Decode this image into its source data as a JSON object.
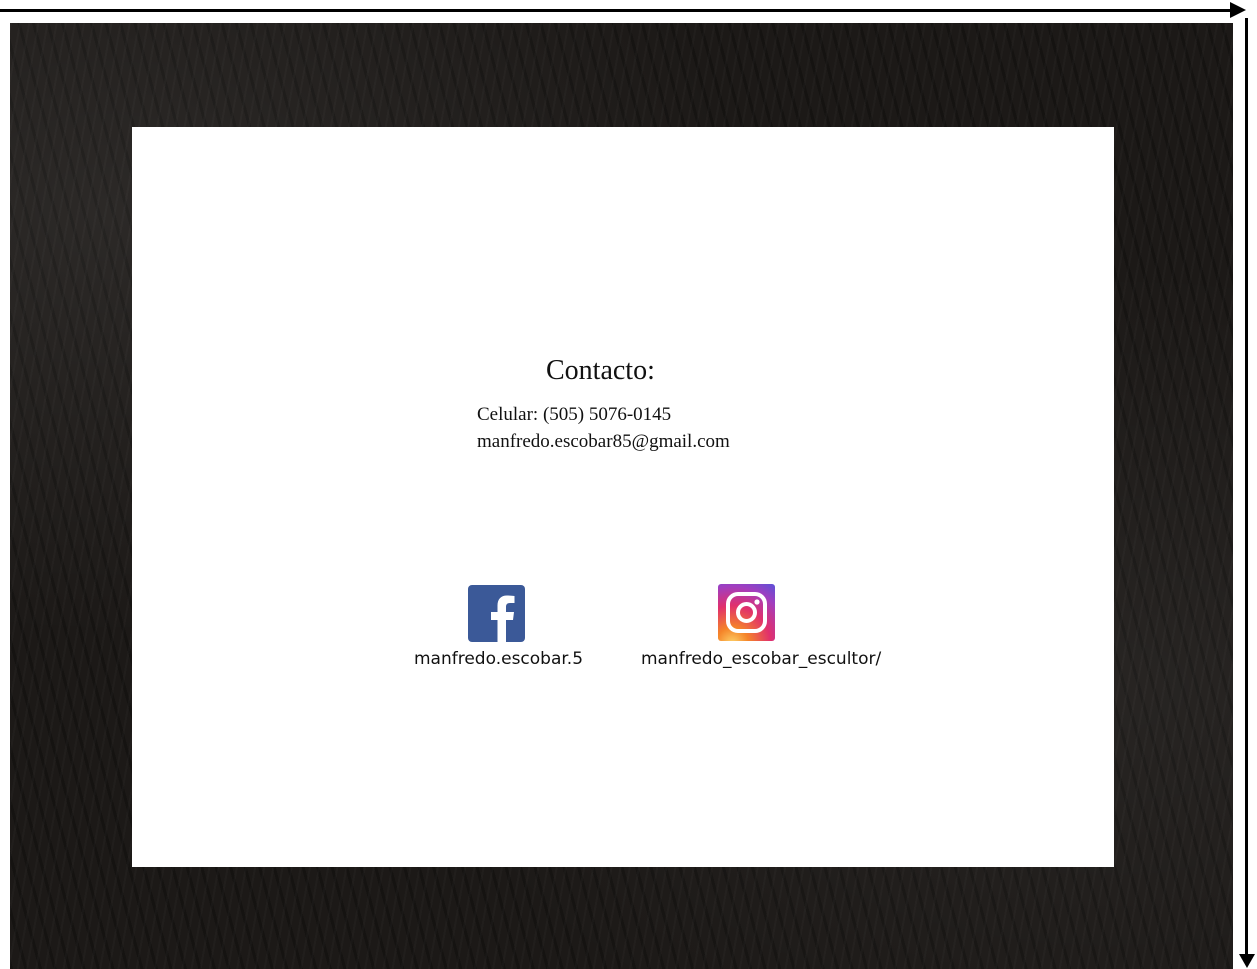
{
  "contact": {
    "title": "Contacto:",
    "phone": "Celular: (505) 5076-0145",
    "email": "manfredo.escobar85@gmail.com"
  },
  "social": {
    "facebook": {
      "icon": "facebook-icon",
      "handle": "manfredo.escobar.5",
      "color": "#3b5998"
    },
    "instagram": {
      "icon": "instagram-icon",
      "handle": "manfredo_escobar_escultor/"
    }
  },
  "colors": {
    "frame": "#1c1917",
    "card": "#ffffff"
  }
}
